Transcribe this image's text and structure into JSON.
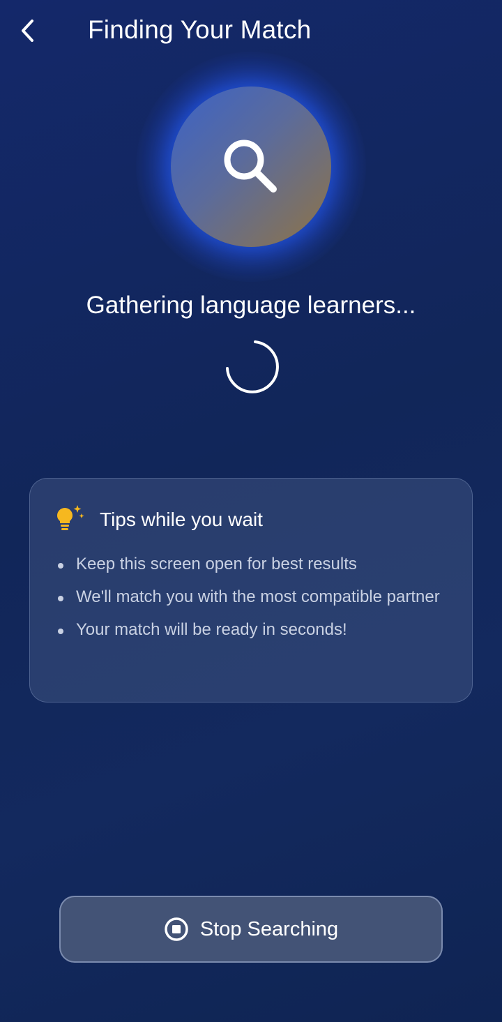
{
  "header": {
    "title": "Finding Your Match",
    "back_icon": "chevron-left-icon"
  },
  "search": {
    "icon": "magnifier-icon",
    "status_text": "Gathering language learners..."
  },
  "tips": {
    "icon": "lightbulb-icon",
    "title": "Tips while you wait",
    "items": [
      "Keep this screen open for best results",
      "We'll match you with the most compatible partner",
      "Your match will be ready in seconds!"
    ]
  },
  "stop_button": {
    "icon": "stop-circle-icon",
    "label": "Stop Searching"
  },
  "colors": {
    "background": "#112659",
    "accent_glow": "#2864ff",
    "lightbulb": "#f6b81f",
    "button": "#435376"
  }
}
